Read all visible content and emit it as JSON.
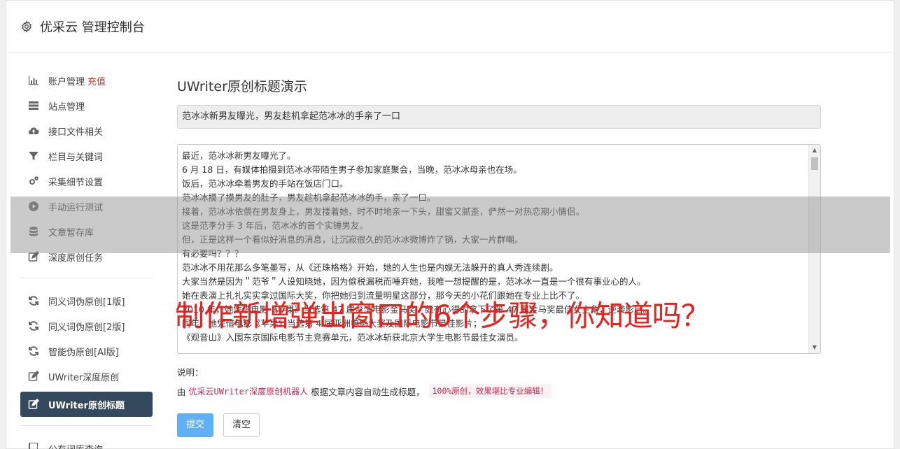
{
  "header": {
    "title": "优采云 管理控制台"
  },
  "sidebar": {
    "items": [
      {
        "label": "账户管理",
        "tag": "充值",
        "icon": "bar-chart-icon"
      },
      {
        "label": "站点管理",
        "icon": "server-icon"
      },
      {
        "label": "接口文件相关",
        "icon": "cloud-upload-icon"
      },
      {
        "label": "栏目与关键词",
        "icon": "filter-icon"
      },
      {
        "label": "采集细节设置",
        "icon": "cogs-icon"
      },
      {
        "label": "手动运行测试",
        "icon": "play-circle-icon"
      },
      {
        "label": "文章暂存库",
        "icon": "database-icon"
      },
      {
        "label": "深度原创任务",
        "icon": "edit-icon"
      },
      {
        "label": "同义词伪原创[1版]",
        "icon": "refresh-icon"
      },
      {
        "label": "同义词伪原创[2版]",
        "icon": "refresh-icon"
      },
      {
        "label": "智能伪原创[AI版]",
        "icon": "refresh-icon"
      },
      {
        "label": "UWriter深度原创",
        "icon": "edit-icon"
      },
      {
        "label": "UWriter原创标题",
        "icon": "edit-icon"
      },
      {
        "label": "公有词库查询",
        "icon": "book-icon"
      }
    ]
  },
  "main": {
    "heading": "UWriter原创标题演示",
    "title_value": "范冰冰新男友曝光，男友趁机拿起范冰冰的手亲了一口",
    "content_lines": [
      "最近，范冰冰新男友曝光了。",
      "6 月 18 日，有媒体拍摄到范冰冰带陌生男子参加家庭聚会，当晚，范冰冰母亲也在场。",
      "饭后，范冰冰牵着男友的手站在饭店门口。",
      "范冰冰摸了摸男友的肚子，男友趁机拿起范冰冰的手，亲了一口。",
      "接着，范冰冰依偎在男友身上，男友搂着她，时不时地亲一下头，甜蜜又腻歪，俨然一对热恋期小情侣。",
      "这是范李分手 3 年后，范冰冰的首个实锤男友。",
      "但，正是这样一个看似好消息的消息，让沉寂很久的范冰冰微博炸了锅，大家一片群嘲。",
      "有必要吗？？？",
      "范冰冰不用花那么多笔墨写，从《还珠格格》开始，她的人生也是内娱无法躲开的真人秀连续剧。",
      "大家当然是因为＂范爷＂人设知晓她，因为偷税漏税而唾弃她，我唯一想提醒的是，范冰冰一直是一个很有事业心的人。",
      "她在表演上扎扎实实拿过国际大奖，你把她归到流量明星这部分，那今天的小花们跟她在专业上比不了。",
      "2010 年，她凭借电影《苹果》当选第 47 届台湾电影金马奖，颇有心得的拿下了第 47 届金马奖最佳女主角，逆袭影后。",
      "同年，她凭借电影《苹果》当选第 4 届亚洲电影大奖及国际电影节最佳影片；",
      "《观音山》入围东京国际电影节主竞赛单元，范冰冰斩获北京大学生电影节最佳女演员。"
    ],
    "note_label": "说明：",
    "note_prefix": "由",
    "note_highlight": "优采云UWriter深度原创机器人",
    "note_middle": "根据文章内容自动生成标题，",
    "note_code": "100%原创，效果堪比专业编辑！",
    "submit_label": "提交",
    "clear_label": "清空"
  },
  "overlay": {
    "caption": "制作新增弹出窗口的6个步骤，你知道吗？"
  },
  "colors": {
    "active_nav": "#34495e",
    "primary_button": "#5fb0f5",
    "tag_red": "#d9362f",
    "overlay_text": "#e8211c"
  }
}
